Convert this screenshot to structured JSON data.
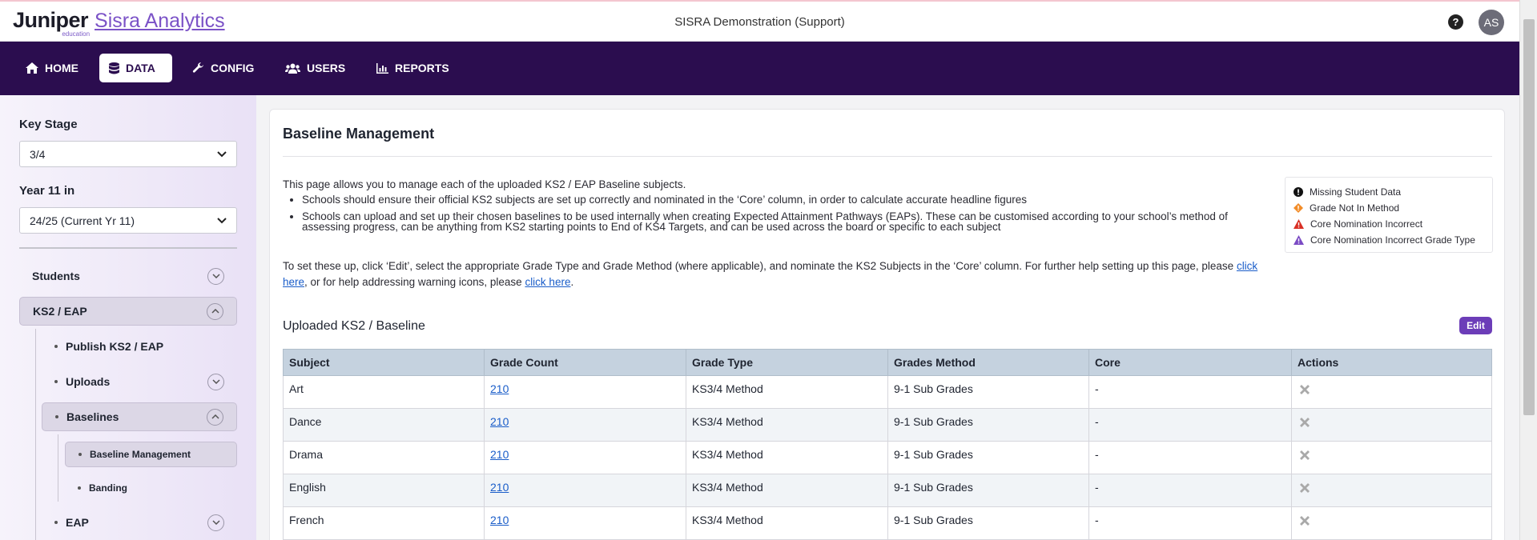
{
  "header": {
    "brand_name": "Juniper",
    "brand_sub": "education",
    "product_name": "Sisra Analytics",
    "org_name": "SISRA Demonstration (Support)",
    "help_symbol": "?",
    "avatar_initials": "AS"
  },
  "nav": {
    "items": [
      {
        "label": "HOME",
        "icon": "home-icon"
      },
      {
        "label": "DATA",
        "icon": "database-icon",
        "active": true
      },
      {
        "label": "CONFIG",
        "icon": "wrench-icon"
      },
      {
        "label": "USERS",
        "icon": "users-icon"
      },
      {
        "label": "REPORTS",
        "icon": "bar-chart-icon"
      }
    ]
  },
  "sidebar": {
    "key_stage_label": "Key Stage",
    "key_stage_value": "3/4",
    "year_label": "Year 11 in",
    "year_value": "24/25 (Current Yr 11)",
    "items": [
      {
        "label": "Students"
      },
      {
        "label": "KS2 / EAP"
      },
      {
        "label": "Publish KS2 / EAP"
      },
      {
        "label": "Uploads"
      },
      {
        "label": "Baselines"
      },
      {
        "label": "Baseline Management"
      },
      {
        "label": "Banding"
      },
      {
        "label": "EAP"
      }
    ]
  },
  "main": {
    "title": "Baseline Management",
    "intro": "This page allows you to manage each of the uploaded KS2 / EAP Baseline subjects.",
    "bullets": [
      "Schools should ensure their official KS2 subjects are set up correctly and nominated in the ‘Core’ column, in order to calculate accurate headline figures",
      "Schools can upload and set up their chosen baselines to be used internally when creating Expected Attainment Pathways (EAPs). These can be customised according to your school’s method of assessing progress, can be anything from KS2 starting points to End of KS4 Targets, and can be used across the board or specific to each subject"
    ],
    "setup_text_1": "To set these up, click ‘Edit’, select the appropriate Grade Type and Grade Method (where applicable), and nominate the KS2 Subjects in the ‘Core’ column. For further help setting up this page, please ",
    "link_1": "click here",
    "setup_text_2": ", or for help addressing warning icons, please ",
    "link_2": "click here",
    "setup_text_3": ".",
    "legend": [
      {
        "label": "Missing Student Data",
        "icon": "exclamation-circle-icon",
        "color": "#111111"
      },
      {
        "label": "Grade Not In Method",
        "icon": "warning-diamond-icon",
        "color": "#f28c28"
      },
      {
        "label": "Core Nomination Incorrect",
        "icon": "warning-triangle-icon",
        "color": "#d93025"
      },
      {
        "label": "Core Nomination Incorrect Grade Type",
        "icon": "warning-triangle-icon",
        "color": "#7b4bc4"
      }
    ],
    "uploaded_title": "Uploaded KS2 / Baseline",
    "edit_label": "Edit",
    "table": {
      "columns": [
        "Subject",
        "Grade Count",
        "Grade Type",
        "Grades Method",
        "Core",
        "Actions"
      ],
      "rows": [
        {
          "subject": "Art",
          "count": "210",
          "type": "KS3/4 Method",
          "method": "9-1 Sub Grades",
          "core": "-"
        },
        {
          "subject": "Dance",
          "count": "210",
          "type": "KS3/4 Method",
          "method": "9-1 Sub Grades",
          "core": "-"
        },
        {
          "subject": "Drama",
          "count": "210",
          "type": "KS3/4 Method",
          "method": "9-1 Sub Grades",
          "core": "-"
        },
        {
          "subject": "English",
          "count": "210",
          "type": "KS3/4 Method",
          "method": "9-1 Sub Grades",
          "core": "-"
        },
        {
          "subject": "French",
          "count": "210",
          "type": "KS3/4 Method",
          "method": "9-1 Sub Grades",
          "core": "-"
        }
      ]
    }
  }
}
